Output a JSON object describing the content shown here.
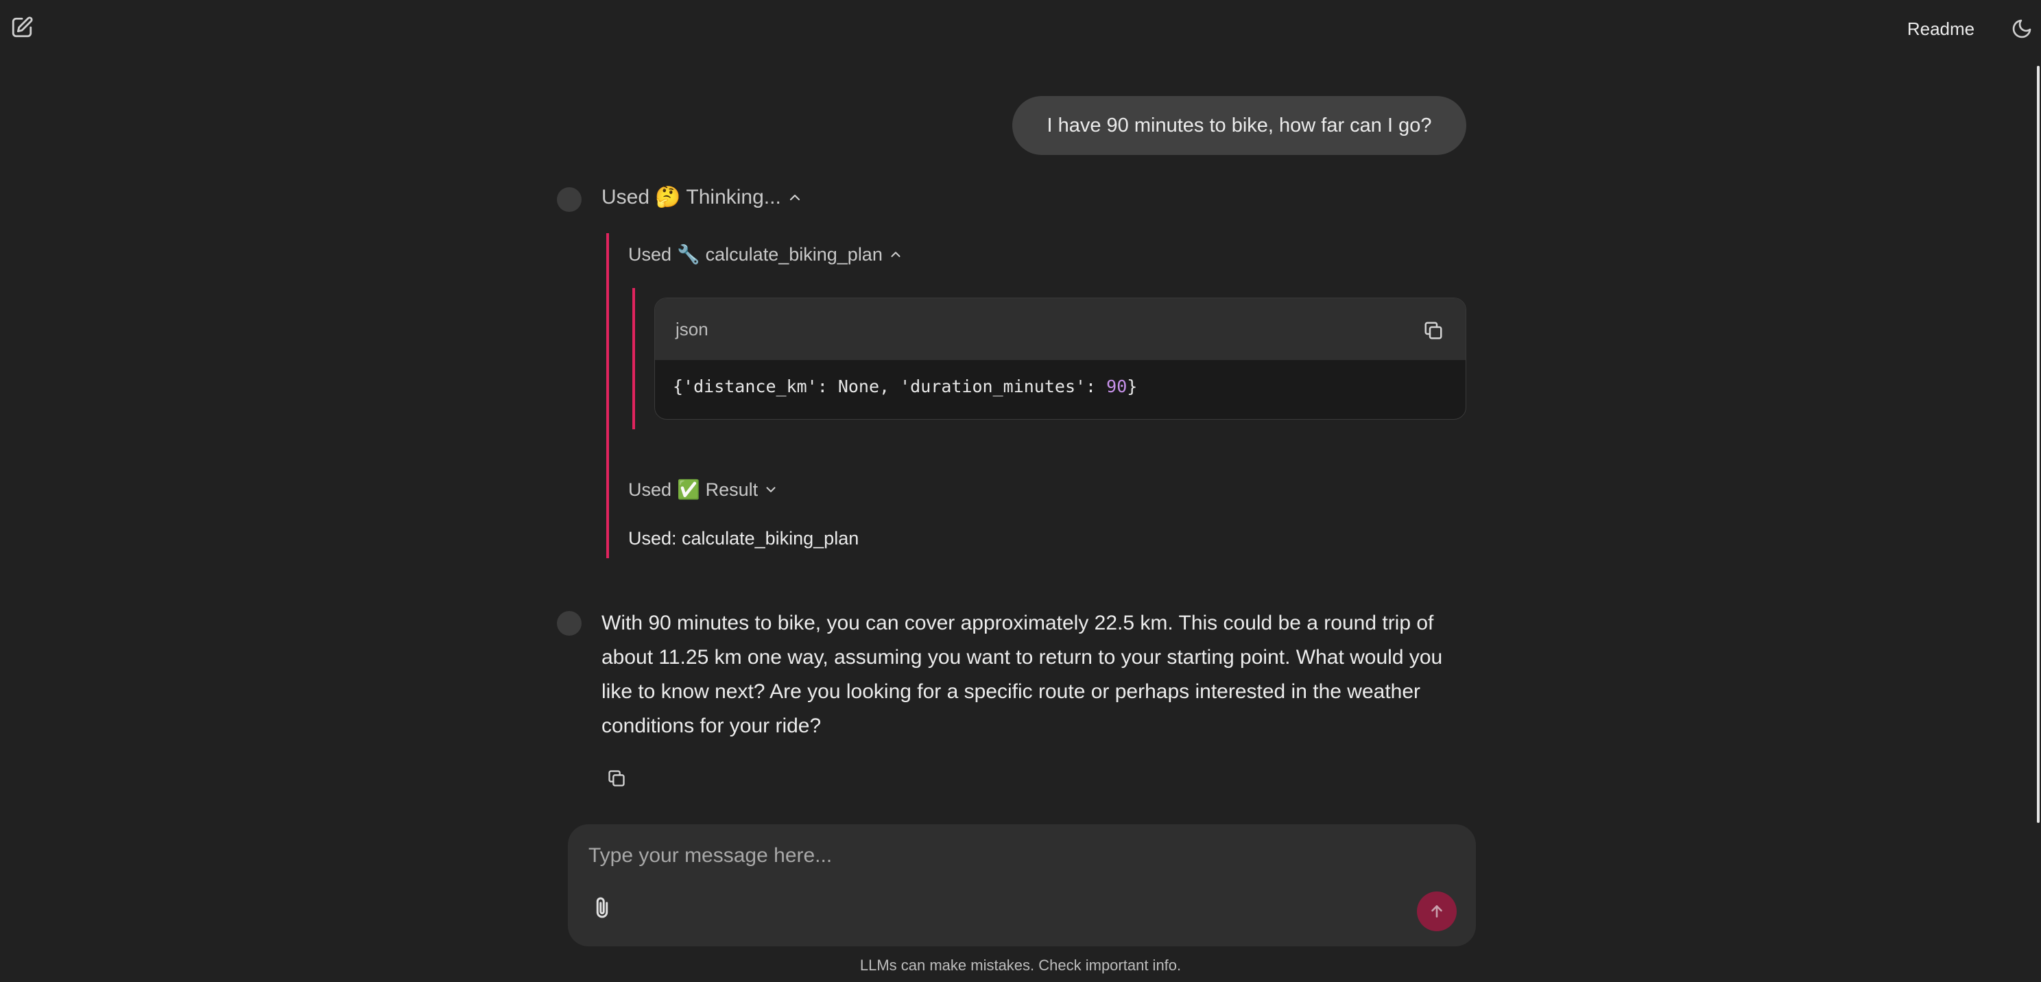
{
  "header": {
    "readme_label": "Readme",
    "new_chat_icon": "edit-icon",
    "theme_icon": "moon-icon"
  },
  "conversation": {
    "user_message": "I have 90 minutes to bike, how far can I go?",
    "thinking_step": {
      "prefix": "Used",
      "emoji": "🤔",
      "label": "Thinking...",
      "state": "expanded"
    },
    "tool_step": {
      "prefix": "Used",
      "emoji": "🔧",
      "label": "calculate_biking_plan",
      "state": "expanded"
    },
    "code_block": {
      "language": "json",
      "code_before": "{'distance_km': None, 'duration_minutes': ",
      "code_number": "90",
      "code_after": "}"
    },
    "result_step": {
      "prefix": "Used",
      "emoji": "✅",
      "label": "Result",
      "state": "collapsed"
    },
    "result_text": "Used: calculate_biking_plan",
    "assistant_message": "With 90 minutes to bike, you can cover approximately 22.5 km. This could be a round trip of about 11.25 km one way, assuming you want to return to your starting point. What would you like to know next? Are you looking for a specific route or perhaps interested in the weather conditions for your ride?"
  },
  "composer": {
    "placeholder": "Type your message here...",
    "value": ""
  },
  "footer": {
    "disclaimer": "LLMs can make mistakes. Check important info."
  },
  "colors": {
    "background": "#212121",
    "accent_line": "#e0245e",
    "send_button": "#8a1d3d",
    "number_highlight": "#c792ea"
  }
}
